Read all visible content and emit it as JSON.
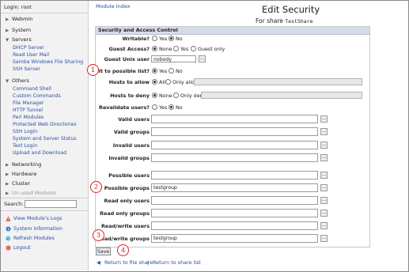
{
  "sidebar": {
    "login": "Login: root",
    "categories": {
      "webmin": "Webmin",
      "system": "System",
      "servers": "Servers",
      "others": "Others",
      "networking": "Networking",
      "hardware": "Hardware",
      "cluster": "Cluster",
      "unused": "Un-used Modules"
    },
    "servers_items": [
      "DHCP Server",
      "Read User Mail",
      "Samba Windows File Sharing",
      "SSH Server"
    ],
    "others_items": [
      "Command Shell",
      "Custom Commands",
      "File Manager",
      "HTTP Tunnel",
      "Perl Modules",
      "Protected Web Directories",
      "SSH Login",
      "System and Server Status",
      "Text Login",
      "Upload and Download"
    ],
    "search_label": "Search:",
    "links": [
      "View Module's Logs",
      "System Information",
      "Refresh Modules",
      "Logout"
    ]
  },
  "main": {
    "module_index": "Module Index",
    "title": "Edit Security",
    "subtitle_prefix": "For share",
    "share_name": "TestShare",
    "panel_header": "Security and Access Control",
    "labels": {
      "writable": "Writable?",
      "guest_access": "Guest Access?",
      "guest_unix_user": "Guest Unix user",
      "limit_possible": "Limit to possible list?",
      "hosts_allow": "Hosts to allow",
      "hosts_deny": "Hosts to deny",
      "revalidate": "Revalidate users?",
      "valid_users": "Valid users",
      "valid_groups": "Valid groups",
      "invalid_users": "Invalid users",
      "invalid_groups": "Invalid groups",
      "possible_users": "Possible users",
      "possible_groups": "Possible groups",
      "read_only_users": "Read only users",
      "read_only_groups": "Read only groups",
      "read_write_users": "Read/write users",
      "read_write_groups": "Read/write groups"
    },
    "options": {
      "yes": "Yes",
      "no": "No",
      "none": "None",
      "guest_only": "Guest only",
      "all": "All",
      "only_allow": "Only allow",
      "only_deny": "Only deny"
    },
    "values": {
      "guest_unix_user": "nobody",
      "possible_groups": "testgroup",
      "read_write_groups": "testgroup"
    },
    "save_label": "Save",
    "return_file_share": "Return to file share",
    "separator": "|",
    "return_share_list": "Return to share list",
    "dots": "..."
  },
  "annotations": [
    "1",
    "2",
    "3",
    "4"
  ],
  "colors": {
    "link": "#2a4fa3",
    "annotation": "#dd2222",
    "panel_header": "#d6dce6"
  }
}
